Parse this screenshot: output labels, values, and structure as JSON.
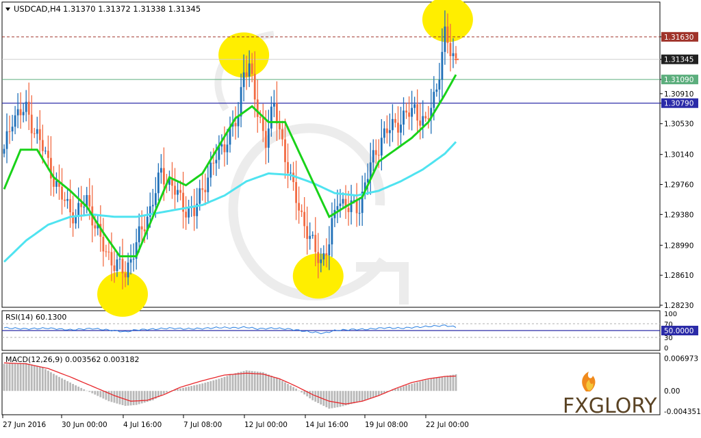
{
  "header": {
    "symbol": "USDCAD,H4",
    "ohlc": "1.31370 1.31372 1.31338 1.31345"
  },
  "colors": {
    "bull": "#1f6fb8",
    "bear": "#f26b43",
    "ma_fast": "#19d219",
    "ma_slow": "#4fe3f0",
    "highlight": "#ffee00",
    "res_line": "#a0332a",
    "green_line": "#5cae7d",
    "blue_line": "#2b2ba8",
    "rsi_line": "#2a7fe0",
    "macd_hist": "#b8b8b8",
    "macd_signal": "#e8262a"
  },
  "chart_data": [
    {
      "type": "candlestick",
      "panel": "price",
      "ylim": [
        1.2823,
        1.3201
      ],
      "y_ticks": [
        "1.31630",
        "1.31345",
        "1.31090",
        "1.30910",
        "1.30790",
        "1.30530",
        "1.30140",
        "1.29760",
        "1.29380",
        "1.28990",
        "1.28610",
        "1.28230"
      ],
      "x_labels": [
        "27 Jun 2016",
        "30 Jun 00:00",
        "4 Jul 16:00",
        "7 Jul 08:00",
        "12 Jul 00:00",
        "14 Jul 16:00",
        "19 Jul 08:00",
        "22 Jul 00:00"
      ],
      "levels": [
        {
          "label": "1.31630",
          "value": 1.3163,
          "style": "dashed",
          "role": "resistance"
        },
        {
          "label": "1.31345",
          "value": 1.31345,
          "style": "solid",
          "role": "current"
        },
        {
          "label": "1.31090",
          "value": 1.3109,
          "style": "solid",
          "role": "green"
        },
        {
          "label": "1.30790",
          "value": 1.3079,
          "style": "solid",
          "role": "blue"
        }
      ],
      "waypoints": [
        [
          0,
          1.3016
        ],
        [
          3,
          1.3062
        ],
        [
          8,
          1.307
        ],
        [
          14,
          1.3022
        ],
        [
          20,
          1.2965
        ],
        [
          26,
          1.2935
        ],
        [
          30,
          1.2958
        ],
        [
          35,
          1.2903
        ],
        [
          40,
          1.2875
        ],
        [
          44,
          1.2865
        ],
        [
          48,
          1.29
        ],
        [
          53,
          1.2945
        ],
        [
          57,
          1.299
        ],
        [
          61,
          1.2975
        ],
        [
          65,
          1.2948
        ],
        [
          69,
          1.294
        ],
        [
          73,
          1.298
        ],
        [
          77,
          1.301
        ],
        [
          81,
          1.3035
        ],
        [
          85,
          1.306
        ],
        [
          87,
          1.3125
        ],
        [
          89,
          1.3125
        ],
        [
          92,
          1.3065
        ],
        [
          95,
          1.3035
        ],
        [
          98,
          1.3075
        ],
        [
          101,
          1.303
        ],
        [
          104,
          1.298
        ],
        [
          107,
          1.2948
        ],
        [
          111,
          1.2905
        ],
        [
          115,
          1.288
        ],
        [
          118,
          1.29
        ],
        [
          121,
          1.296
        ],
        [
          125,
          1.2945
        ],
        [
          129,
          1.295
        ],
        [
          133,
          1.3
        ],
        [
          137,
          1.3035
        ],
        [
          141,
          1.305
        ],
        [
          145,
          1.306
        ],
        [
          149,
          1.3072
        ],
        [
          153,
          1.305
        ],
        [
          157,
          1.31
        ],
        [
          160,
          1.3163
        ],
        [
          162,
          1.3145
        ],
        [
          164,
          1.31345
        ]
      ],
      "ma_fast": [
        [
          0,
          1.297
        ],
        [
          6,
          1.302
        ],
        [
          12,
          1.302
        ],
        [
          18,
          1.2985
        ],
        [
          24,
          1.2968
        ],
        [
          30,
          1.2948
        ],
        [
          36,
          1.2915
        ],
        [
          42,
          1.2885
        ],
        [
          48,
          1.2885
        ],
        [
          54,
          1.2935
        ],
        [
          60,
          1.2985
        ],
        [
          66,
          1.2975
        ],
        [
          72,
          1.299
        ],
        [
          78,
          1.3025
        ],
        [
          84,
          1.306
        ],
        [
          90,
          1.3075
        ],
        [
          96,
          1.3055
        ],
        [
          102,
          1.3055
        ],
        [
          108,
          1.301
        ],
        [
          114,
          1.2965
        ],
        [
          118,
          1.2935
        ],
        [
          124,
          1.2948
        ],
        [
          130,
          1.296
        ],
        [
          136,
          1.3005
        ],
        [
          142,
          1.302
        ],
        [
          148,
          1.3035
        ],
        [
          154,
          1.3055
        ],
        [
          160,
          1.309
        ],
        [
          164,
          1.3115
        ]
      ],
      "ma_slow": [
        [
          0,
          1.2878
        ],
        [
          8,
          1.2905
        ],
        [
          16,
          1.2925
        ],
        [
          24,
          1.2935
        ],
        [
          32,
          1.2938
        ],
        [
          40,
          1.2935
        ],
        [
          48,
          1.2935
        ],
        [
          56,
          1.294
        ],
        [
          64,
          1.2945
        ],
        [
          72,
          1.295
        ],
        [
          80,
          1.2962
        ],
        [
          88,
          1.298
        ],
        [
          96,
          1.299
        ],
        [
          104,
          1.2988
        ],
        [
          112,
          1.2978
        ],
        [
          120,
          1.2965
        ],
        [
          128,
          1.2962
        ],
        [
          136,
          1.2968
        ],
        [
          144,
          1.298
        ],
        [
          152,
          1.2995
        ],
        [
          160,
          1.3015
        ],
        [
          164,
          1.303
        ]
      ],
      "highlights": [
        {
          "index": 43,
          "value": 1.2837
        },
        {
          "index": 87,
          "value": 1.314
        },
        {
          "index": 114,
          "value": 1.286
        },
        {
          "index": 161,
          "value": 1.3185
        }
      ]
    },
    {
      "type": "line",
      "panel": "rsi",
      "name": "RSI(14) 60.1300",
      "ylim": [
        0,
        100
      ],
      "y_ticks": [
        "100",
        "70",
        "50.0000",
        "30",
        "0"
      ],
      "levels": [
        70,
        50,
        30
      ],
      "values": [
        [
          0,
          58
        ],
        [
          8,
          55
        ],
        [
          16,
          57
        ],
        [
          24,
          52
        ],
        [
          32,
          56
        ],
        [
          40,
          50
        ],
        [
          44,
          46
        ],
        [
          48,
          52
        ],
        [
          54,
          54
        ],
        [
          60,
          57
        ],
        [
          66,
          55
        ],
        [
          72,
          56
        ],
        [
          78,
          59
        ],
        [
          84,
          58
        ],
        [
          88,
          60
        ],
        [
          92,
          55
        ],
        [
          98,
          57
        ],
        [
          104,
          54
        ],
        [
          110,
          47
        ],
        [
          116,
          42
        ],
        [
          120,
          50
        ],
        [
          126,
          53
        ],
        [
          132,
          54
        ],
        [
          138,
          58
        ],
        [
          144,
          57
        ],
        [
          150,
          60
        ],
        [
          156,
          63
        ],
        [
          160,
          65
        ],
        [
          164,
          60.13
        ]
      ]
    },
    {
      "type": "histogram",
      "panel": "macd",
      "name": "MACD(12,26,9) 0.003562 0.003182",
      "ylim": [
        -0.0048,
        0.0075
      ],
      "y_ticks": [
        "0.006973",
        "0.00",
        "-0.004351"
      ],
      "values": [
        [
          0,
          0.0058
        ],
        [
          8,
          0.006
        ],
        [
          14,
          0.005
        ],
        [
          20,
          0.003
        ],
        [
          26,
          0.0012
        ],
        [
          32,
          -0.0005
        ],
        [
          38,
          -0.0022
        ],
        [
          44,
          -0.0032
        ],
        [
          48,
          -0.003
        ],
        [
          54,
          -0.002
        ],
        [
          60,
          0.0
        ],
        [
          66,
          0.0008
        ],
        [
          72,
          0.0016
        ],
        [
          78,
          0.0026
        ],
        [
          84,
          0.0038
        ],
        [
          88,
          0.0044
        ],
        [
          94,
          0.004
        ],
        [
          100,
          0.0025
        ],
        [
          106,
          0.0005
        ],
        [
          112,
          -0.002
        ],
        [
          118,
          -0.0038
        ],
        [
          122,
          -0.0034
        ],
        [
          128,
          -0.0025
        ],
        [
          134,
          -0.0014
        ],
        [
          140,
          0.0
        ],
        [
          146,
          0.0012
        ],
        [
          152,
          0.0022
        ],
        [
          158,
          0.003
        ],
        [
          164,
          0.003562
        ]
      ],
      "signal": [
        [
          0,
          0.006
        ],
        [
          8,
          0.0058
        ],
        [
          16,
          0.0048
        ],
        [
          24,
          0.003
        ],
        [
          32,
          0.001
        ],
        [
          40,
          -0.001
        ],
        [
          46,
          -0.0022
        ],
        [
          52,
          -0.002
        ],
        [
          58,
          -0.0008
        ],
        [
          64,
          0.0008
        ],
        [
          72,
          0.0022
        ],
        [
          80,
          0.0034
        ],
        [
          88,
          0.0038
        ],
        [
          94,
          0.0036
        ],
        [
          100,
          0.0026
        ],
        [
          106,
          0.001
        ],
        [
          112,
          -0.0008
        ],
        [
          118,
          -0.0022
        ],
        [
          124,
          -0.0028
        ],
        [
          130,
          -0.0022
        ],
        [
          136,
          -0.001
        ],
        [
          142,
          0.0005
        ],
        [
          148,
          0.0018
        ],
        [
          154,
          0.0026
        ],
        [
          160,
          0.0031
        ],
        [
          164,
          0.003182
        ]
      ]
    }
  ],
  "logo": {
    "text": "FXGLORY"
  }
}
